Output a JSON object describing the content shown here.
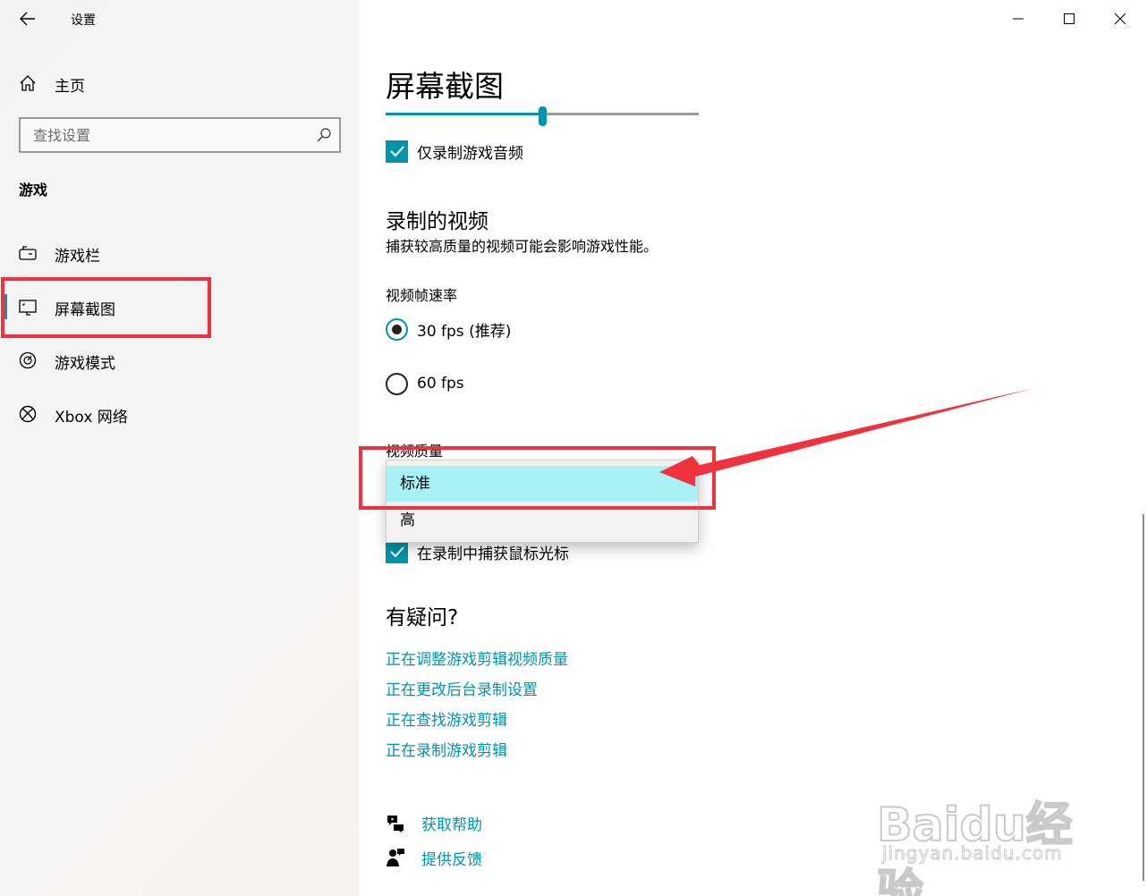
{
  "window": {
    "title": "设置",
    "controls": [
      "minimize-icon",
      "maximize-icon",
      "close-icon"
    ]
  },
  "sidebar": {
    "home_label": "主页",
    "search_placeholder": "查找设置",
    "section_heading": "游戏",
    "items": [
      {
        "label": "游戏栏",
        "icon": "game-bar-icon",
        "active": false
      },
      {
        "label": "屏幕截图",
        "icon": "captures-icon",
        "active": true
      },
      {
        "label": "游戏模式",
        "icon": "game-mode-icon",
        "active": false
      },
      {
        "label": "Xbox 网络",
        "icon": "xbox-icon",
        "active": false
      }
    ]
  },
  "main": {
    "page_title": "屏幕截图",
    "volume_slider_fraction": 0.5,
    "record_game_audio_only": {
      "label": "仅录制游戏音频",
      "checked": true
    },
    "recorded_video": {
      "title": "录制的视频",
      "description": "捕获较高质量的视频可能会影响游戏性能。",
      "frame_rate_label": "视频帧速率",
      "frame_rate_options": [
        {
          "label": "30 fps (推荐)",
          "selected": true
        },
        {
          "label": "60 fps",
          "selected": false
        }
      ],
      "quality_label": "视频质量",
      "quality_options": [
        {
          "label": "标准",
          "selected": true
        },
        {
          "label": "高",
          "selected": false
        }
      ],
      "capture_cursor": {
        "label": "在录制中捕获鼠标光标",
        "checked": true
      }
    },
    "help": {
      "title": "有疑问?",
      "links": [
        "正在调整游戏剪辑视频质量",
        "正在更改后台录制设置",
        "正在查找游戏剪辑",
        "正在录制游戏剪辑"
      ]
    },
    "footer": {
      "get_help": "获取帮助",
      "feedback": "提供反馈"
    }
  },
  "colors": {
    "accent": "#0095a8",
    "annotation_red": "#f0323e",
    "dropdown_highlight": "#a8f2f6"
  },
  "watermark": {
    "main": "Baidu经验",
    "sub": "jingyan.baidu.com"
  }
}
